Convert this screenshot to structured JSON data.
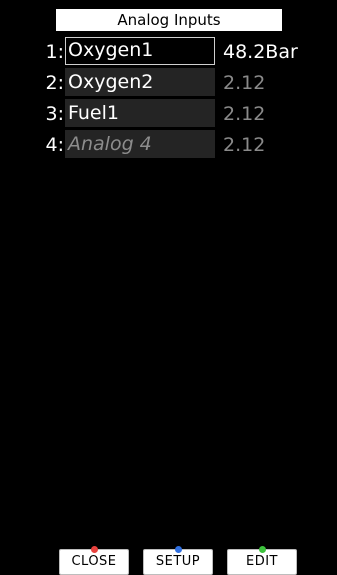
{
  "title": "Analog Inputs",
  "inputs": [
    {
      "num": "1:",
      "name": "Oxygen1",
      "value": "48.2Bar"
    },
    {
      "num": "2:",
      "name": "Oxygen2",
      "value": "2.12"
    },
    {
      "num": "3:",
      "name": "Fuel1",
      "value": "2.12"
    },
    {
      "num": "4:",
      "name": "Analog 4",
      "value": "2.12"
    }
  ],
  "buttons": {
    "close": {
      "label": "CLOSE",
      "dot_color": "#e8413d",
      "dot_icon": "red-dot-icon"
    },
    "setup": {
      "label": "SETUP",
      "dot_color": "#2f6fe0",
      "dot_icon": "blue-dot-icon"
    },
    "edit": {
      "label": "EDIT",
      "dot_color": "#3cc23c",
      "dot_icon": "green-dot-icon"
    }
  }
}
